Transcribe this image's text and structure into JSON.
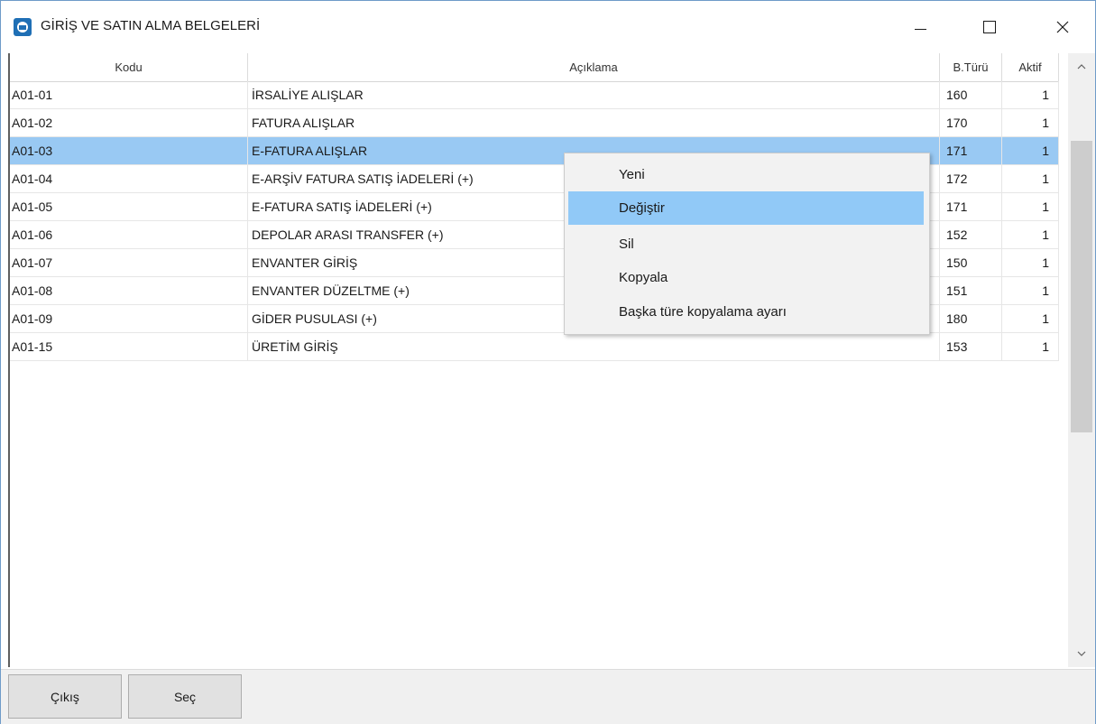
{
  "window": {
    "title": "GİRİŞ VE SATIN ALMA BELGELERİ",
    "icon": "app-icon"
  },
  "table": {
    "columns": [
      "Kodu",
      "Açıklama",
      "B.Türü",
      "Aktif"
    ],
    "rows": [
      {
        "kodu": "A01-01",
        "aciklama": "İRSALİYE ALIŞLAR",
        "tur": "160",
        "aktif": "1"
      },
      {
        "kodu": "A01-02",
        "aciklama": "FATURA ALIŞLAR",
        "tur": "170",
        "aktif": "1"
      },
      {
        "kodu": "A01-03",
        "aciklama": "E-FATURA ALIŞLAR",
        "tur": "171",
        "aktif": "1"
      },
      {
        "kodu": "A01-04",
        "aciklama": "E-ARŞİV FATURA SATIŞ İADELERİ (+)",
        "tur": "172",
        "aktif": "1"
      },
      {
        "kodu": "A01-05",
        "aciklama": "E-FATURA SATIŞ İADELERİ (+)",
        "tur": "171",
        "aktif": "1"
      },
      {
        "kodu": "A01-06",
        "aciklama": "DEPOLAR ARASI TRANSFER (+)",
        "tur": "152",
        "aktif": "1"
      },
      {
        "kodu": "A01-07",
        "aciklama": "ENVANTER GİRİŞ",
        "tur": "150",
        "aktif": "1"
      },
      {
        "kodu": "A01-08",
        "aciklama": "ENVANTER DÜZELTME (+)",
        "tur": "151",
        "aktif": "1"
      },
      {
        "kodu": "A01-09",
        "aciklama": "GİDER PUSULASI (+)",
        "tur": "180",
        "aktif": "1"
      },
      {
        "kodu": "A01-15",
        "aciklama": "ÜRETİM GİRİŞ",
        "tur": "153",
        "aktif": "1"
      }
    ],
    "selected_row": 2
  },
  "context_menu": {
    "items": [
      "Yeni",
      "Değiştir",
      "Sil",
      "Kopyala",
      "Başka türe kopyalama ayarı"
    ],
    "active_item": 1
  },
  "buttons": {
    "exit_label": "Çıkış",
    "select_label": "Seç"
  },
  "colors": {
    "selected_row": "#99c9f3",
    "menu_highlight": "#91c9f7",
    "window_border": "#6e9bc9"
  }
}
